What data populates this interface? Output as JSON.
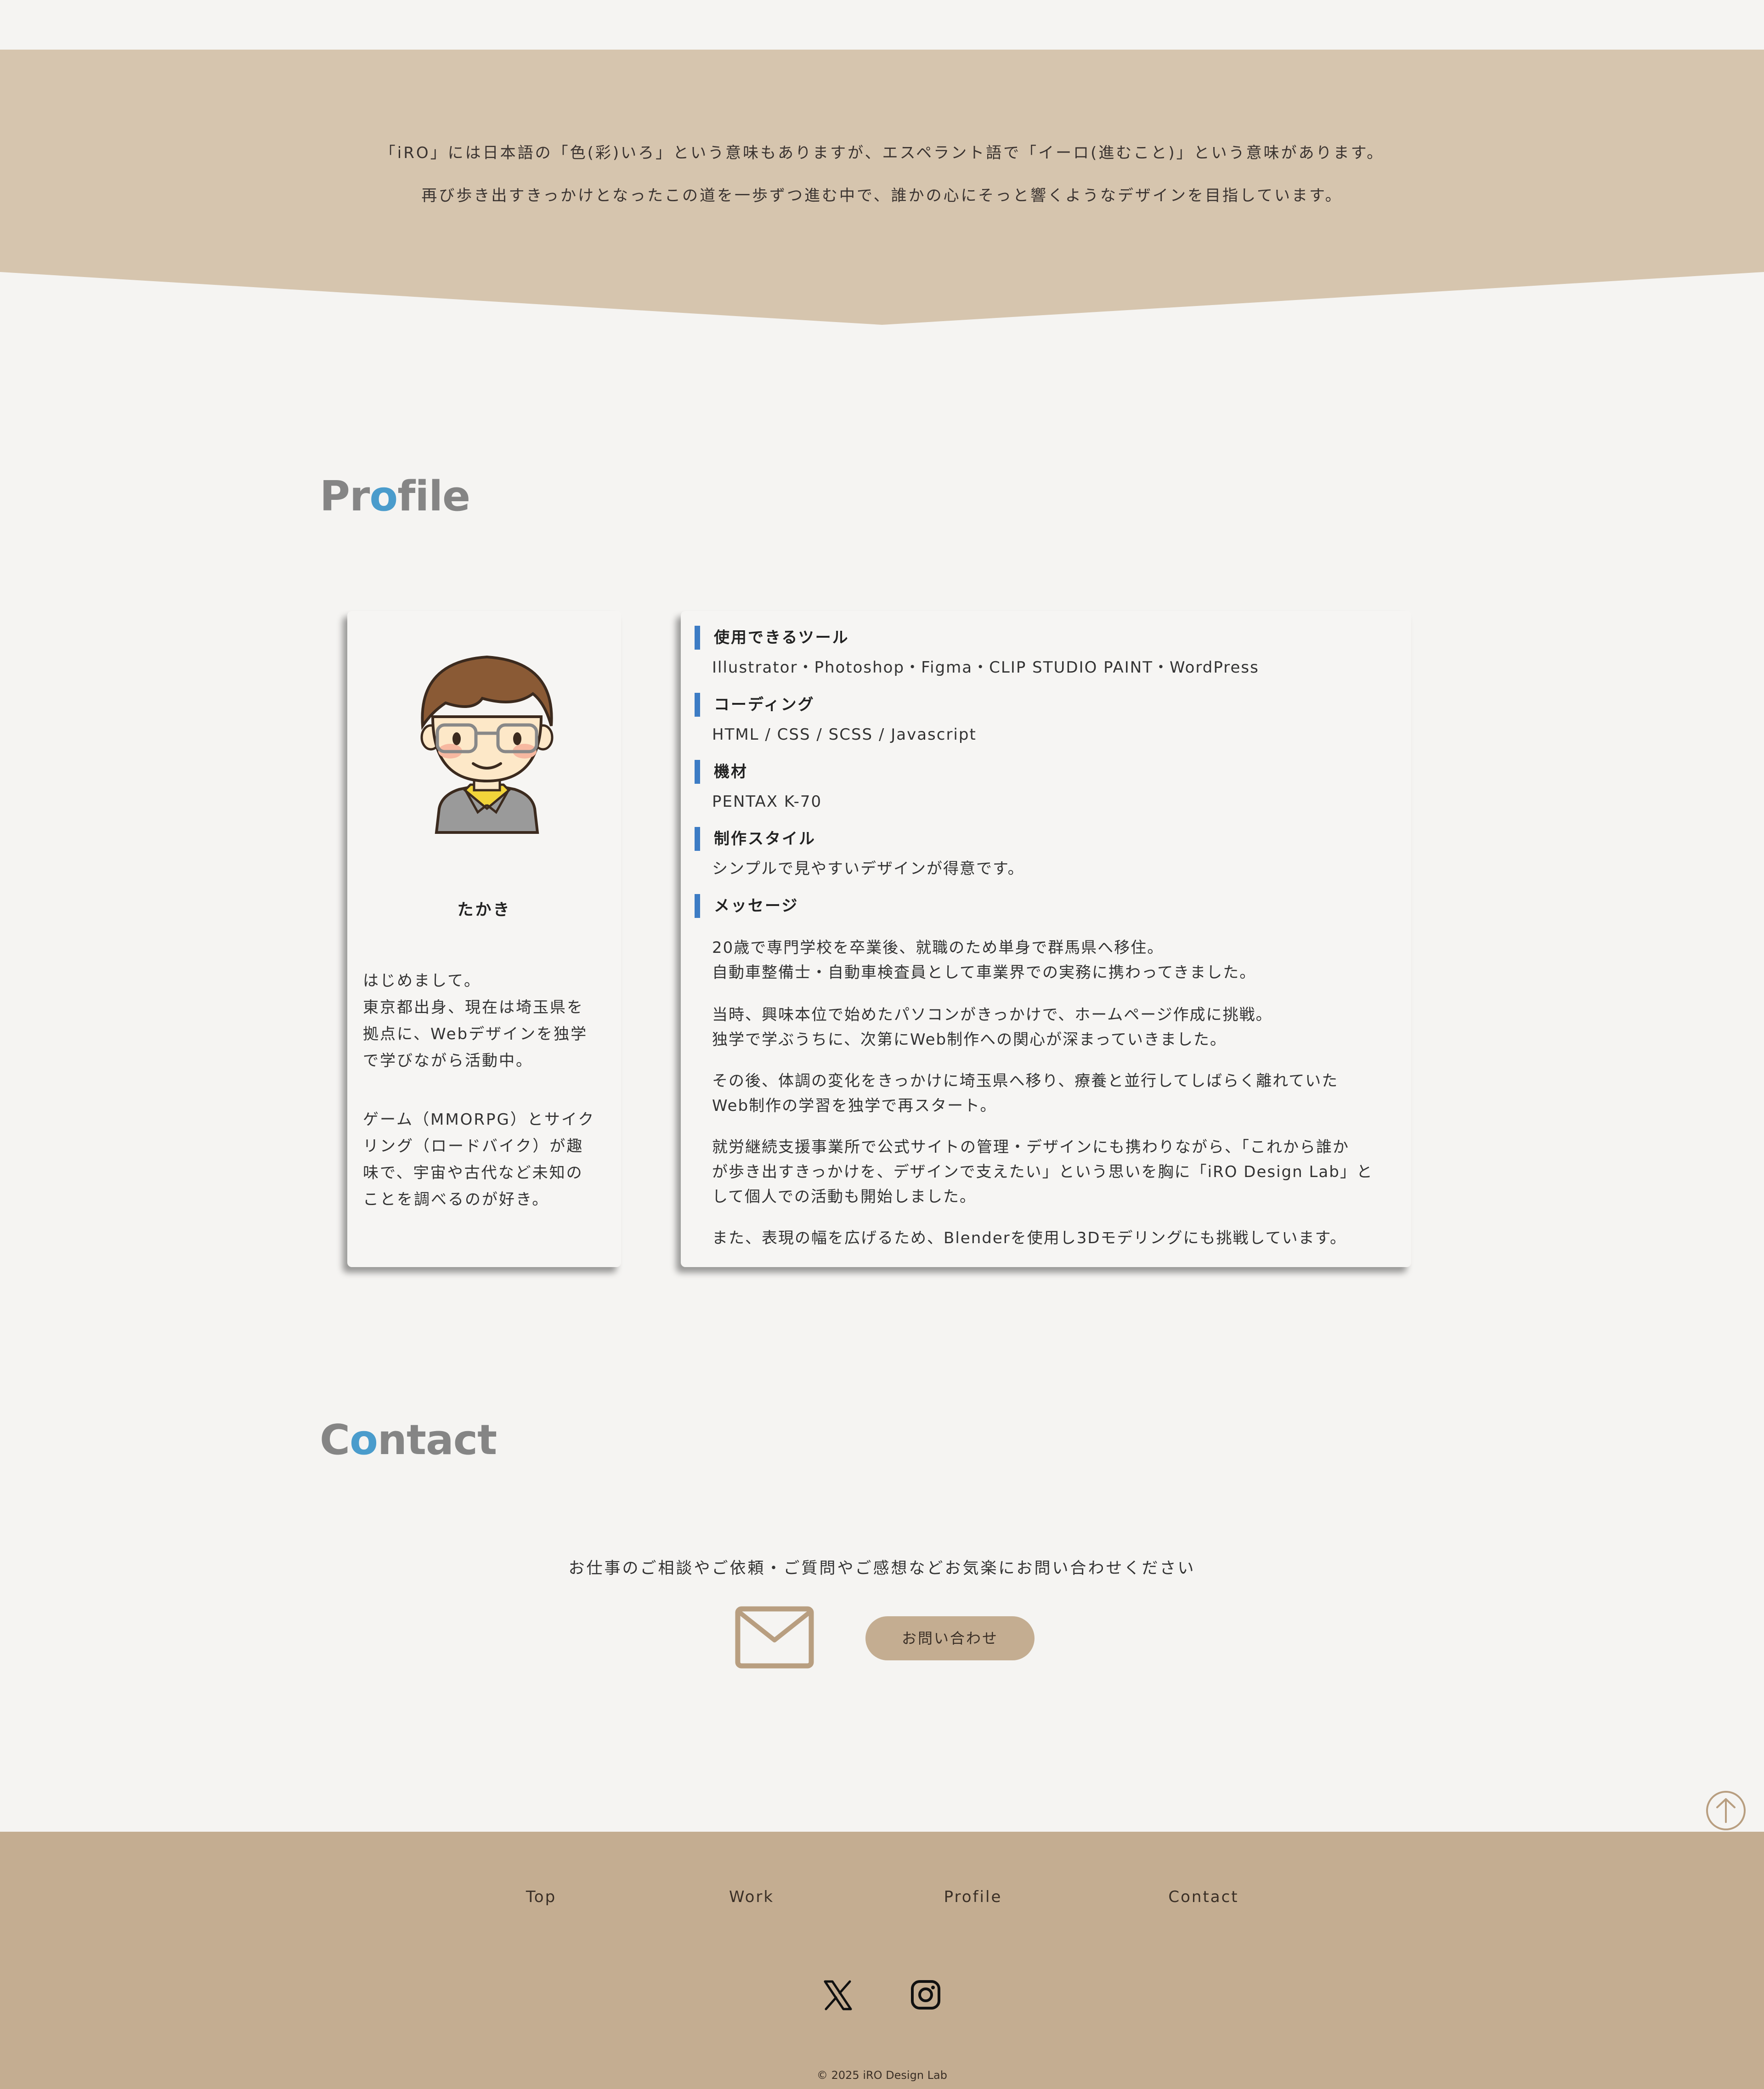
{
  "colors": {
    "background": "#f5f4f2",
    "hero": "#d6c5ae",
    "footer": "#c4ad91",
    "accent_blue": "#4a9ccc",
    "info_bar": "#3d7cc4"
  },
  "hero": {
    "line1": "「iRO」には日本語の「色(彩)いろ」という意味もありますが、エスペラント語で「イーロ(進むこと)」という意味があります。",
    "line2": "再び歩き出すきっかけとなったこの道を一歩ずつ進む中で、誰かの心にそっと響くようなデザインを目指しています。"
  },
  "profile": {
    "title_pre": "Pr",
    "title_accent": "o",
    "title_post": "file",
    "name": "たかき",
    "bio_para1": [
      "はじめまして。",
      "東京都出身、現在は埼玉県を",
      "拠点に、Webデザインを独学",
      "で学びながら活動中。"
    ],
    "bio_para2": [
      "ゲーム（MMORPG）とサイク",
      "リング（ロードバイク）が趣",
      "味で、宇宙や古代など未知の",
      "ことを調べるのが好き。"
    ],
    "sections": {
      "tools": {
        "heading": "使用できるツール",
        "body": "Illustrator・Photoshop・Figma・CLIP STUDIO PAINT・WordPress"
      },
      "coding": {
        "heading": "コーディング",
        "body": "HTML / CSS / SCSS / Javascript"
      },
      "equipment": {
        "heading": "機材",
        "body": "PENTAX K-70"
      },
      "style": {
        "heading": "制作スタイル",
        "body": "シンプルで見やすいデザインが得意です。"
      },
      "message": {
        "heading": "メッセージ",
        "p1": [
          "20歳で専門学校を卒業後、就職のため単身で群馬県へ移住。",
          "自動車整備士・自動車検査員として車業界での実務に携わってきました。"
        ],
        "p2": [
          "当時、興味本位で始めたパソコンがきっかけで、ホームページ作成に挑戦。",
          "独学で学ぶうちに、次第にWeb制作への関心が深まっていきました。"
        ],
        "p3": [
          "その後、体調の変化をきっかけに埼玉県へ移り、療養と並行してしばらく離れていた",
          "Web制作の学習を独学で再スタート。"
        ],
        "p4": [
          "就労継続支援事業所で公式サイトの管理・デザインにも携わりながら、「これから誰か",
          "が歩き出すきっかけを、デザインで支えたい」という思いを胸に「iRO Design Lab」と",
          "して個人での活動も開始しました。"
        ],
        "p5": [
          "また、表現の幅を広げるため、Blenderを使用し3Dモデリングにも挑戦しています。"
        ]
      }
    }
  },
  "contact": {
    "title_pre": "C",
    "title_accent": "o",
    "title_post": "ntact",
    "lead": "お仕事のご相談やご依頼・ご質問やご感想などお気楽にお問い合わせください",
    "mail_icon": "mail-icon",
    "button_label": "お問い合わせ"
  },
  "back_to_top_icon": "arrow-up-circle-icon",
  "footer": {
    "nav": [
      "Top",
      "Work",
      "Profile",
      "Contact"
    ],
    "social": [
      "x-icon",
      "instagram-icon"
    ],
    "copyright": "© 2025 iRO Design Lab"
  }
}
